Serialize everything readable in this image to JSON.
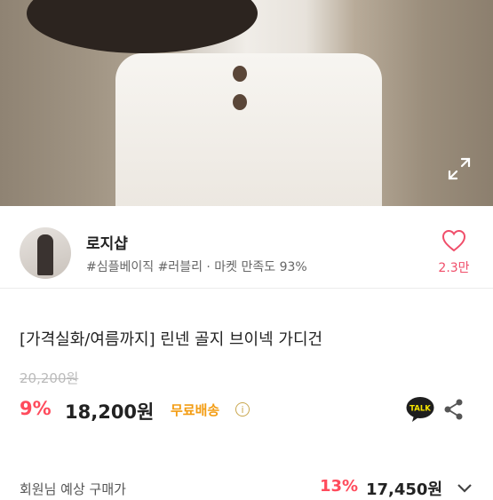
{
  "product_image": {
    "alt": ""
  },
  "shop": {
    "name": "로지샵",
    "tags": "#심플베이직 #러블리 · 마켓 만족도 93%",
    "likes": "2.3만"
  },
  "product": {
    "title": "[가격실화/여름까지] 린넨 골지 브이넥 가디건",
    "original_price": "20,200원",
    "discount": "9%",
    "price": "18,200원",
    "shipping": "무료배송"
  },
  "member_price": {
    "label": "회원님 예상 구매가",
    "discount": "13%",
    "price": "17,450원"
  },
  "colors": {
    "accent": "#ff4b5c",
    "shipping": "#f39c12"
  }
}
